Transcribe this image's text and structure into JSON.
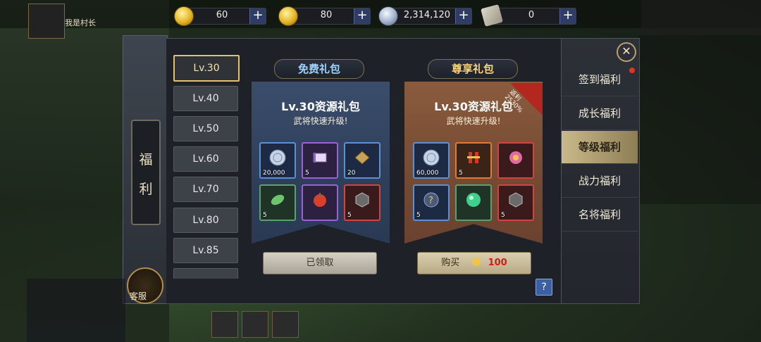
{
  "resources": [
    {
      "icon": "gold-coin-icon",
      "value": "60"
    },
    {
      "icon": "gold-ingot-icon",
      "value": "80"
    },
    {
      "icon": "silver-coin-icon",
      "value": "2,314,120"
    },
    {
      "icon": "scroll-icon",
      "value": "0"
    }
  ],
  "player": {
    "name": "我是村长"
  },
  "side_tab": {
    "char1": "福",
    "char2": "利",
    "kefu": "客服"
  },
  "levels": [
    "Lv.30",
    "Lv.40",
    "Lv.50",
    "Lv.60",
    "Lv.70",
    "Lv.80",
    "Lv.85"
  ],
  "selected_level": "Lv.30",
  "free_pack": {
    "header": "免费礼包",
    "title": "Lv.30资源礼包",
    "subtitle": "武将快速升级!",
    "items": [
      {
        "name": "silver",
        "count": "20,000"
      },
      {
        "name": "scroll",
        "count": "5"
      },
      {
        "name": "board",
        "count": "20"
      },
      {
        "name": "leaf",
        "count": "5"
      },
      {
        "name": "fruit",
        "count": ""
      },
      {
        "name": "ornament",
        "count": "5"
      }
    ],
    "button": "已领取"
  },
  "vip_pack": {
    "header": "尊享礼包",
    "title": "Lv.30资源礼包",
    "subtitle": "武将快速升级!",
    "badge": "返利 2530%",
    "items": [
      {
        "name": "silver",
        "count": "60,000"
      },
      {
        "name": "firecracker",
        "count": "5"
      },
      {
        "name": "gift",
        "count": ""
      },
      {
        "name": "mystery",
        "count": "5"
      },
      {
        "name": "orb",
        "count": ""
      },
      {
        "name": "ornament",
        "count": "5"
      }
    ],
    "button": "购买",
    "price": "100"
  },
  "nav": [
    "签到福利",
    "成长福利",
    "等级福利",
    "战力福利",
    "名将福利"
  ],
  "selected_nav": "等级福利",
  "colors": {
    "accent": "#e3c36a",
    "free": "#2e3f5a",
    "vip": "#744a32"
  }
}
